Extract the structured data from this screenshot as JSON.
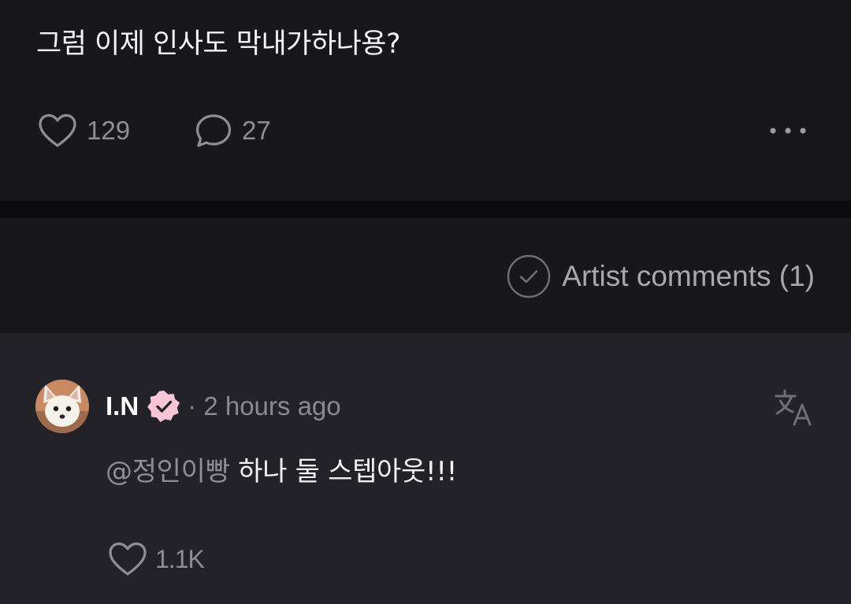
{
  "post": {
    "text": "그럼 이제 인사도 막내가하나용?",
    "like_count": "129",
    "comment_count": "27",
    "icons": {
      "like": "heart-outline-icon",
      "comment": "speech-bubble-icon",
      "more": "more-horizontal-icon"
    }
  },
  "filter": {
    "label": "Artist comments (1)",
    "icon": "check-circle-icon"
  },
  "comment": {
    "author": "I.N",
    "meta": "· 2 hours ago",
    "mention": "@정인이빵",
    "text": "하나 둘 스텝아웃!!!",
    "like_count": "1.1K",
    "icons": {
      "verified": "verified-badge-icon",
      "translate": "translate-icon",
      "like": "heart-outline-icon"
    }
  },
  "colors": {
    "background": "#17171c",
    "comment_background": "#222228",
    "muted_text": "#8e8e95",
    "verified_badge": "#f7c5d6"
  }
}
